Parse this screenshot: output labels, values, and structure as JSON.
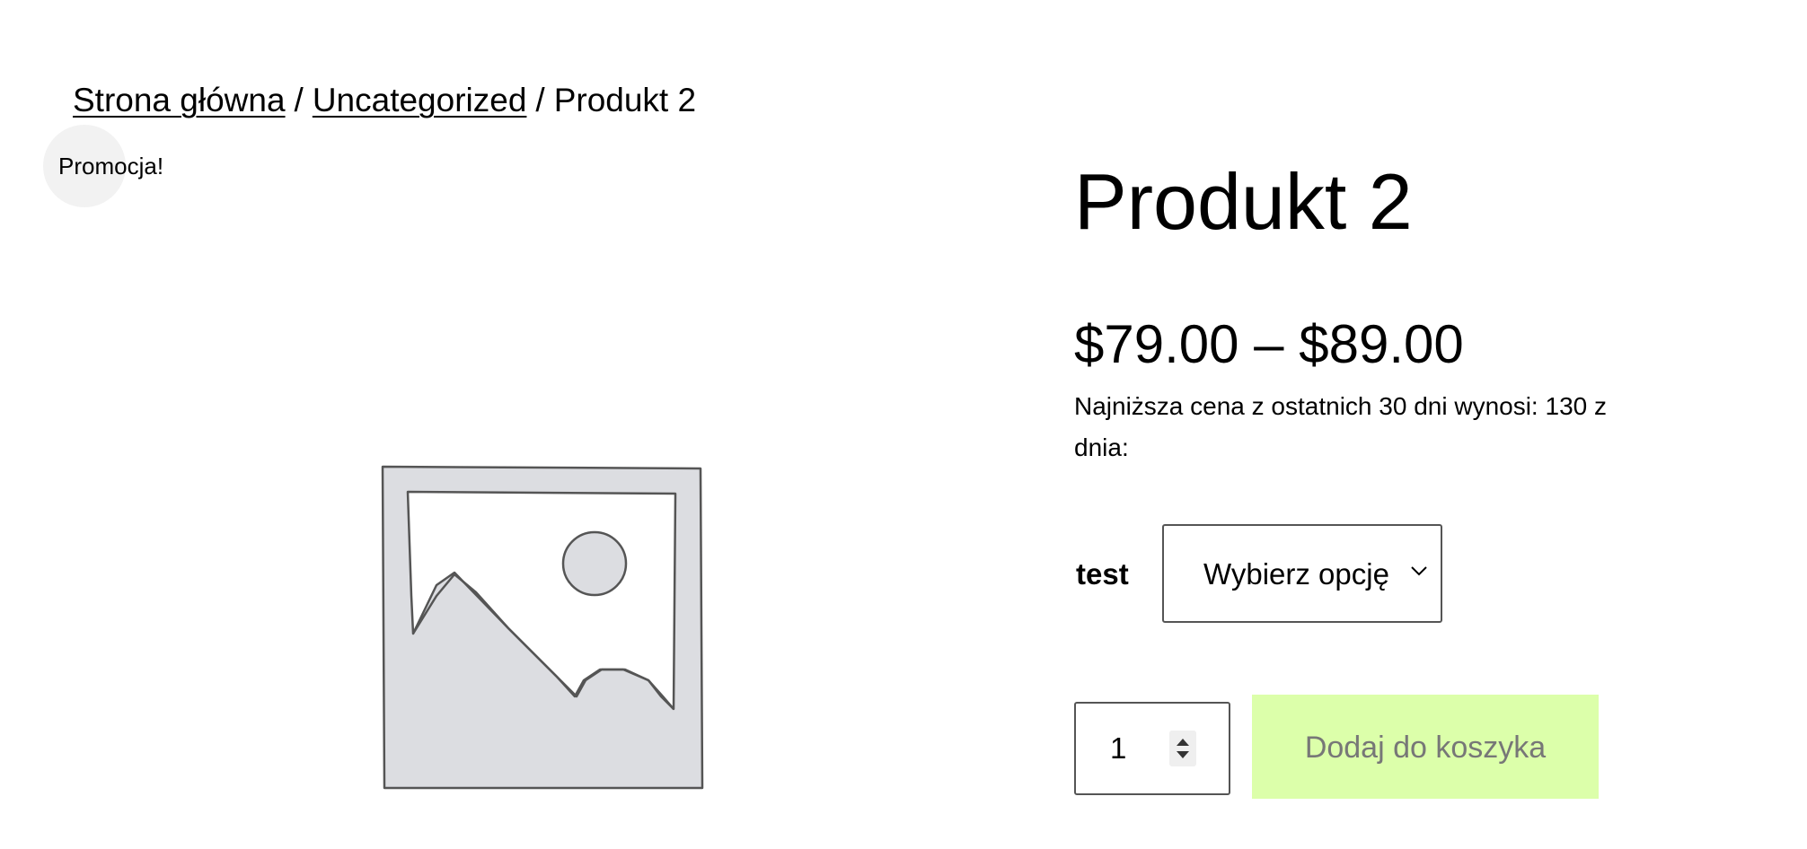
{
  "breadcrumb": {
    "home": "Strona główna",
    "separator": "/",
    "category": "Uncategorized",
    "current": "Produkt 2"
  },
  "badge": {
    "label": "Promocja!"
  },
  "product": {
    "title": "Produkt 2",
    "price_range": "$79.00 – $89.00",
    "lowest_price_note": "Najniższa cena z ostatnich 30 dni wynosi: 130 z dnia:",
    "image_icon": "placeholder-image-icon"
  },
  "variation": {
    "label": "test",
    "selected_value": "Wybierz opcję"
  },
  "cart": {
    "quantity": "1",
    "add_to_cart_label": "Dodaj do koszyka",
    "button_color": "#dcffaa",
    "button_text_color": "#777777"
  }
}
